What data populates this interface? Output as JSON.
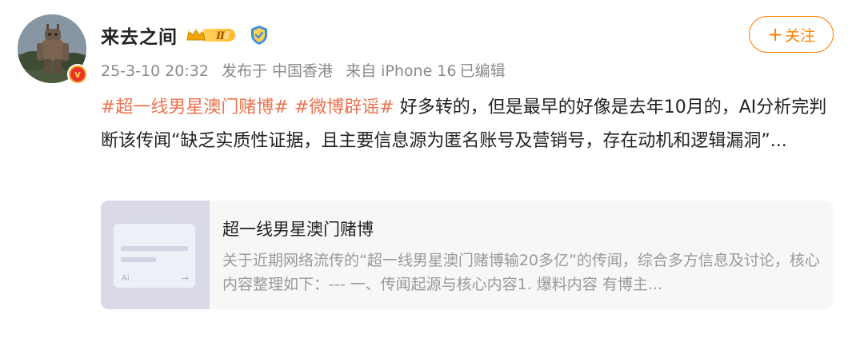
{
  "user": {
    "name": "来去之间",
    "vip_level": "Ⅱ",
    "verify_mark": "v"
  },
  "meta": {
    "timestamp": "25-3-10 20:32",
    "location": "发布于 中国香港",
    "source": "来自 iPhone 16",
    "edited": "已编辑"
  },
  "follow_button": {
    "plus": "+",
    "label": "关注"
  },
  "post": {
    "hashtag1": "#超一线男星澳门赌博#",
    "hashtag2": "#微博辟谣#",
    "text": "好多转的，但是最早的好像是去年10月的，AI分析完判断该传闻“缺乏实质性证据，且主要信息源为匿名账号及营销号，存在动机和逻辑漏洞”..."
  },
  "card": {
    "thumb_ai_label": "Ai",
    "thumb_arrow": "→",
    "title": "超一线男星澳门赌博",
    "description": "关于近期网络流传的“超一线男星澳门赌博输20多亿”的传闻，综合多方信息及讨论，核心内容整理如下：--- 一、传闻起源与核心内容1. 爆料内容 有博主..."
  },
  "colors": {
    "accent": "#ff8200",
    "hashtag": "#eb7350",
    "meta": "#8a8a8a"
  }
}
